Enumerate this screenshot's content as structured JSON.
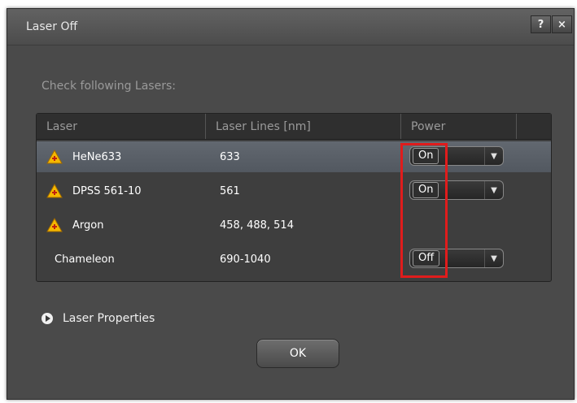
{
  "dialog": {
    "title": "Laser Off",
    "help_label": "?",
    "close_label": "×",
    "check_label": "Check following Lasers:",
    "ok_label": "OK",
    "laser_properties_label": "Laser Properties"
  },
  "table": {
    "headers": [
      "Laser",
      "Laser Lines [nm]",
      "Power"
    ],
    "rows": [
      {
        "name": "HeNe633",
        "lines": "633",
        "power": "On",
        "warning": true,
        "selected": true
      },
      {
        "name": "DPSS 561-10",
        "lines": "561",
        "power": "On",
        "warning": true,
        "selected": false
      },
      {
        "name": "Argon",
        "lines": "458, 488, 514",
        "power": null,
        "warning": true,
        "selected": false
      },
      {
        "name": "Chameleon",
        "lines": "690-1040",
        "power": "Off",
        "warning": false,
        "selected": false
      }
    ]
  },
  "icons": {
    "warning": "warning-triangle-icon",
    "dropdown": "chevron-down-icon",
    "expand": "expand-arrow-icon"
  },
  "colors": {
    "highlight": "#e01c1c",
    "warning": "#f5b800"
  }
}
